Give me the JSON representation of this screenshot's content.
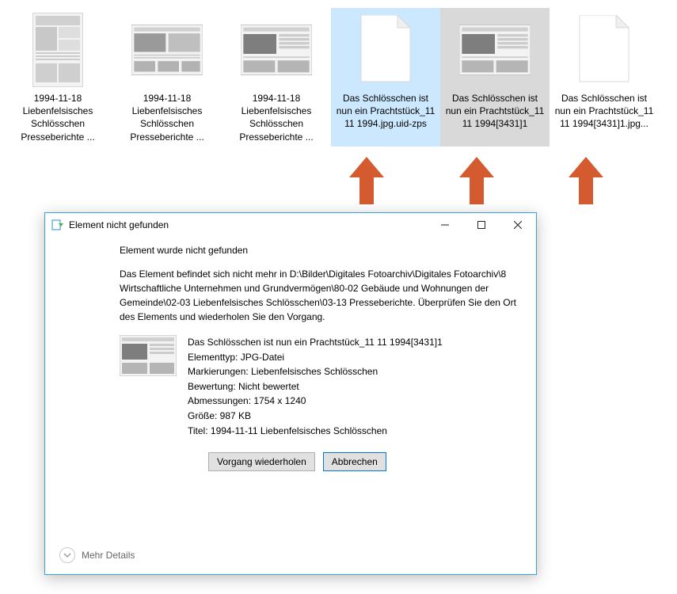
{
  "files": [
    {
      "label": "1994-11-18 Liebenfelsisches Schlösschen Presseberichte ...",
      "kind": "news-tall",
      "state": ""
    },
    {
      "label": "1994-11-18 Liebenfelsisches Schlösschen Presseberichte ...",
      "kind": "news-wide",
      "state": ""
    },
    {
      "label": "1994-11-18 Liebenfelsisches Schlösschen Presseberichte ...",
      "kind": "news-wide",
      "state": ""
    },
    {
      "label": "Das Schlösschen ist nun ein Prachtstück_11 11 1994.jpg.uid-zps",
      "kind": "blank",
      "state": "selected"
    },
    {
      "label": "Das Schlösschen ist nun ein Prachtstück_11 11 1994[3431]1",
      "kind": "news-wide",
      "state": "hover"
    },
    {
      "label": "Das Schlösschen ist nun ein Prachtstück_11 11 1994[3431]1.jpg...",
      "kind": "blank",
      "state": ""
    }
  ],
  "arrow_color": "#d35b2f",
  "dialog": {
    "title": "Element nicht gefunden",
    "line1": "Element wurde nicht gefunden",
    "paragraph": "Das Element befindet sich nicht mehr in D:\\Bilder\\Digitales Fotoarchiv\\Digitales Fotoarchiv\\8 Wirtschaftliche Unternehmen und Grundvermögen\\80-02 Gebäude und Wohnungen der Gemeinde\\02-03 Liebenfelsisches Schlösschen\\03-13 Presseberichte. Überprüfen Sie den Ort des Elements und wiederholen Sie den Vorgang.",
    "details": {
      "name": "Das Schlösschen ist nun ein Prachtstück_11 11 1994[3431]1",
      "type_label": "Elementtyp: JPG-Datei",
      "tags_label": "Markierungen: Liebenfelsisches Schlösschen",
      "rating_label": "Bewertung: Nicht bewertet",
      "dim_label": "Abmessungen: 1754 x 1240",
      "size_label": "Größe: 987 KB",
      "title_label": "Titel: 1994-11-11 Liebenfelsisches Schlösschen"
    },
    "retry_label": "Vorgang wiederholen",
    "cancel_label": "Abbrechen",
    "more_label": "Mehr Details"
  }
}
